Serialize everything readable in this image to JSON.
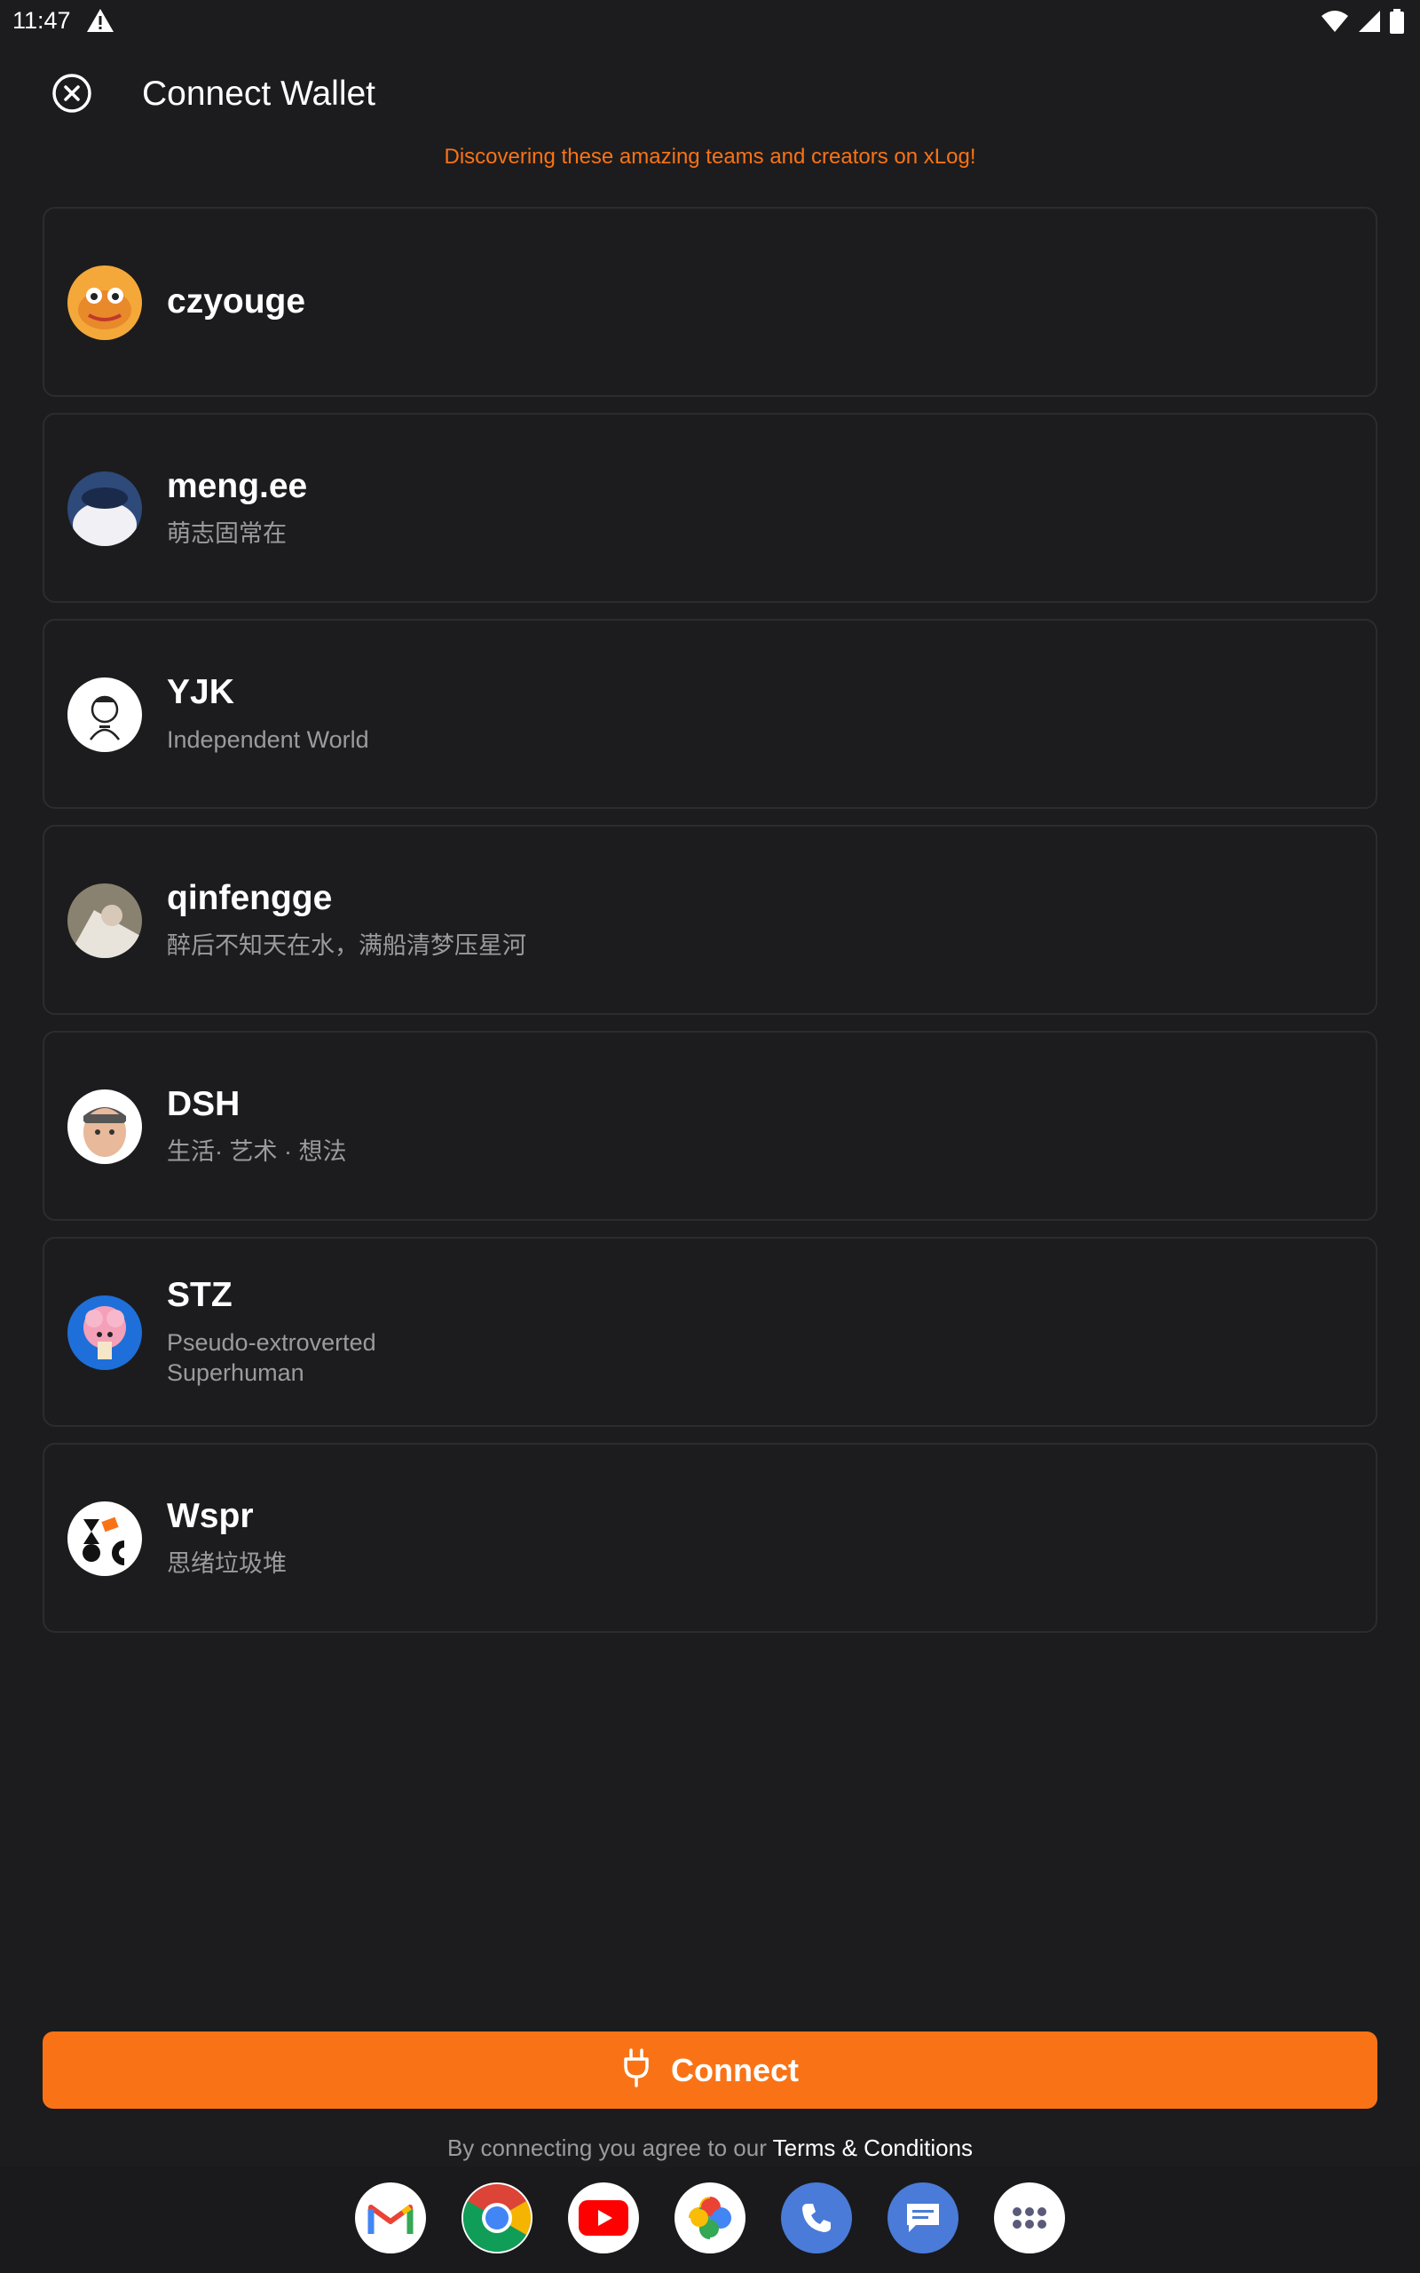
{
  "status_bar": {
    "time": "11:47"
  },
  "header": {
    "title": "Connect Wallet"
  },
  "banner": "Discovering these amazing teams and creators on xLog!",
  "creators": [
    {
      "name": "czyouge",
      "bio": ""
    },
    {
      "name": "meng.ee",
      "bio": "萌志固常在"
    },
    {
      "name": "YJK",
      "bio": "Independent World"
    },
    {
      "name": "qinfengge",
      "bio": "醉后不知天在水，满船清梦压星河"
    },
    {
      "name": "DSH",
      "bio": "生活· 艺术 · 想法"
    },
    {
      "name": "STZ",
      "bio": "Pseudo-extroverted Superhuman"
    },
    {
      "name": "Wspr",
      "bio": "思绪垃圾堆"
    }
  ],
  "connect_button": {
    "label": "Connect"
  },
  "terms": {
    "prefix": "By connecting you agree to our ",
    "link": "Terms & Conditions"
  },
  "colors": {
    "accent": "#f97316",
    "background": "#1c1c1e"
  },
  "dock": [
    "gmail-icon",
    "chrome-icon",
    "youtube-icon",
    "photos-icon",
    "phone-icon",
    "messages-icon",
    "app-drawer-icon"
  ]
}
